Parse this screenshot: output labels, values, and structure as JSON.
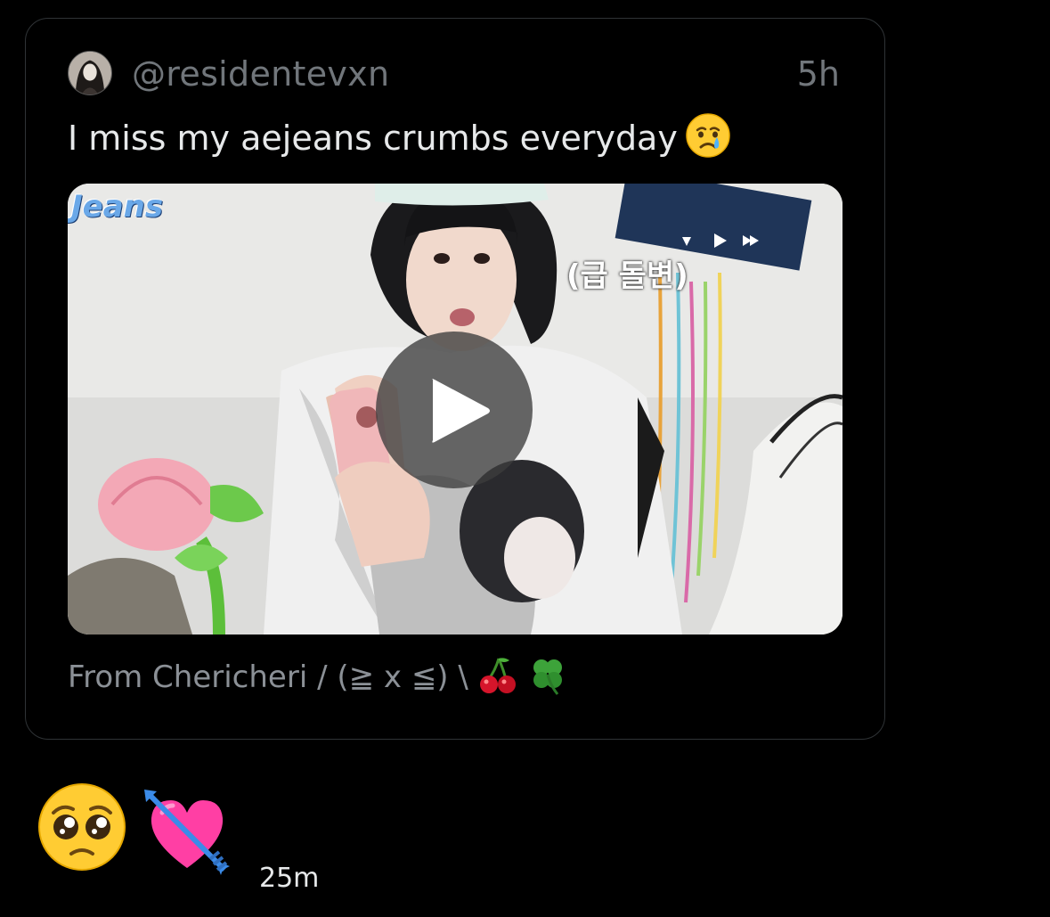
{
  "tweet": {
    "handle": "@residentevxn",
    "time": "5h",
    "text": "I miss my aejeans crumbs everyday",
    "text_emoji": "crying-face-emoji",
    "media": {
      "logo_text": "Jeans",
      "subtitle": "(급 돌변)",
      "play_icon": "play-icon"
    },
    "source": "From Chericheri / (≧ x ≦) \\",
    "source_emojis": [
      "cherries-emoji",
      "four-leaf-clover-emoji"
    ]
  },
  "reply": {
    "emojis": [
      "pleading-face-emoji",
      "heart-with-arrow-emoji"
    ],
    "time": "25m"
  },
  "colors": {
    "background": "#000000",
    "muted_text": "#71767b",
    "primary_text": "#e7e9ea",
    "card_border": "#2f3336"
  }
}
